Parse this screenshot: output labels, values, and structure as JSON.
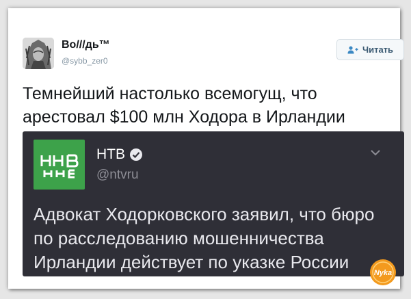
{
  "tweet": {
    "author_name": "Bo///дь™",
    "author_handle": "@sybb_zer0",
    "follow_label": "Читать",
    "text": "Темнейший настолько всемогущ, что арестовал $100 млн Ходора в Ирландии"
  },
  "quoted": {
    "name": "НТВ",
    "handle": "@ntvru",
    "text": "Адвокат Ходорковского заявил, что бюро по расследованию мошенничества Ирландии действует по указке России"
  },
  "icons": {
    "follow": "add-user-icon",
    "verified": "verified-badge-icon",
    "menu": "chevron-down-icon"
  },
  "colors": {
    "quote_bg": "#2f2f37",
    "ntv_green": "#3da24a",
    "follow_text": "#3b5a72",
    "watermark": "#f39a1e"
  },
  "watermark_text": "Nyka"
}
